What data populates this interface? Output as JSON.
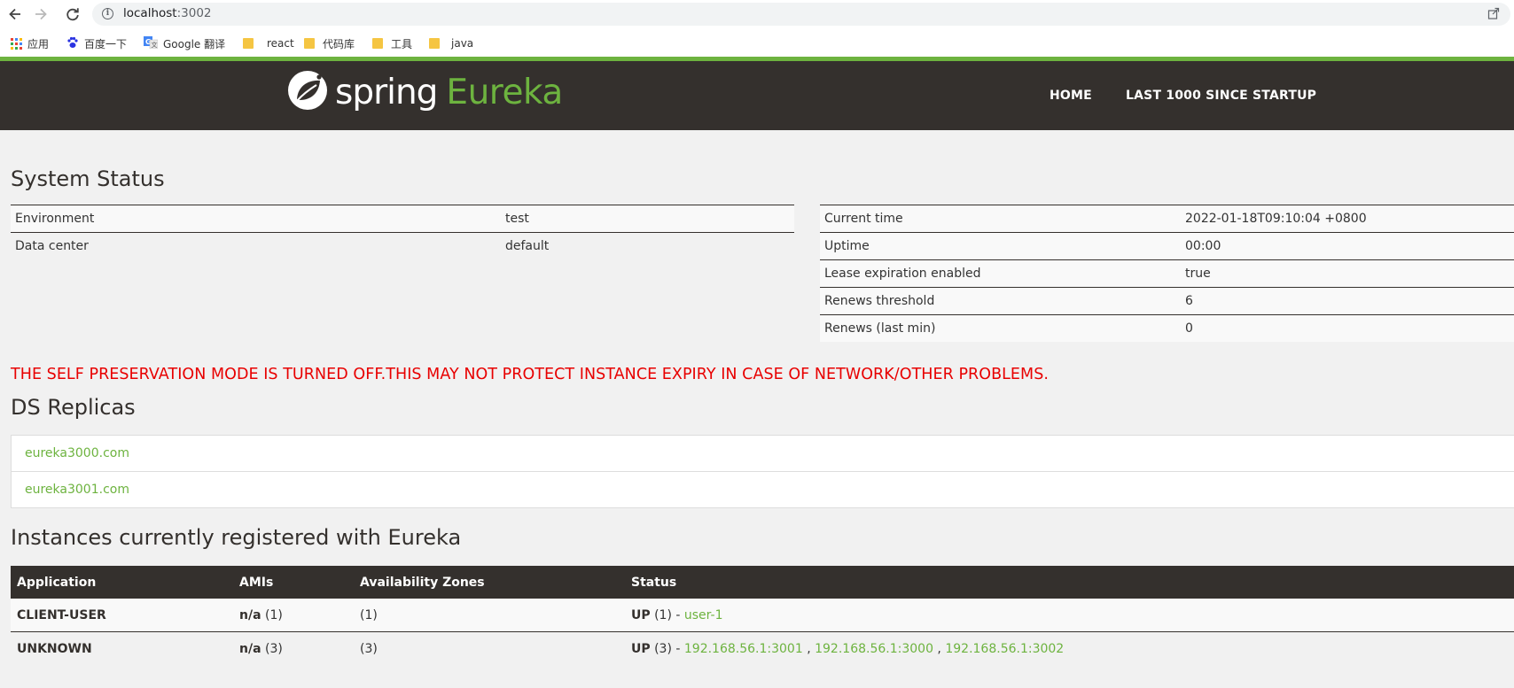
{
  "browser": {
    "url_host": "localhost",
    "url_port": ":3002",
    "bookmarks": [
      {
        "label": "应用",
        "icon": "apps-grid-icon"
      },
      {
        "label": "百度一下",
        "icon": "baidu-paw-icon"
      },
      {
        "label": "Google 翻译",
        "icon": "google-translate-icon"
      },
      {
        "label": "react",
        "icon": "folder-icon"
      },
      {
        "label": "代码库",
        "icon": "folder-icon"
      },
      {
        "label": "工具",
        "icon": "folder-icon"
      },
      {
        "label": "java",
        "icon": "folder-icon"
      }
    ]
  },
  "header": {
    "logo_spring": "spring",
    "logo_eureka": "Eureka",
    "nav": [
      "HOME",
      "LAST 1000 SINCE STARTUP"
    ]
  },
  "system_status": {
    "title": "System Status",
    "left": [
      {
        "key": "Environment",
        "value": "test"
      },
      {
        "key": "Data center",
        "value": "default"
      }
    ],
    "right": [
      {
        "key": "Current time",
        "value": "2022-01-18T09:10:04 +0800"
      },
      {
        "key": "Uptime",
        "value": "00:00"
      },
      {
        "key": "Lease expiration enabled",
        "value": "true"
      },
      {
        "key": "Renews threshold",
        "value": "6"
      },
      {
        "key": "Renews (last min)",
        "value": "0"
      }
    ]
  },
  "warning": "THE SELF PRESERVATION MODE IS TURNED OFF.THIS MAY NOT PROTECT INSTANCE EXPIRY IN CASE OF NETWORK/OTHER PROBLEMS.",
  "ds_replicas": {
    "title": "DS Replicas",
    "items": [
      "eureka3000.com",
      "eureka3001.com"
    ]
  },
  "instances": {
    "title": "Instances currently registered with Eureka",
    "columns": [
      "Application",
      "AMIs",
      "Availability Zones",
      "Status"
    ],
    "rows": [
      {
        "application": "CLIENT-USER",
        "amis_bold": "n/a",
        "amis_count": " (1)",
        "zones": "(1)",
        "status_bold": "UP",
        "status_count": " (1) - ",
        "links": [
          "user-1"
        ]
      },
      {
        "application": "UNKNOWN",
        "amis_bold": "n/a",
        "amis_count": " (3)",
        "zones": "(3)",
        "status_bold": "UP",
        "status_count": " (3) - ",
        "links": [
          "192.168.56.1:3001",
          "192.168.56.1:3000",
          "192.168.56.1:3002"
        ]
      }
    ]
  },
  "colors": {
    "spring_green": "#6db33f",
    "header_dark": "#34302d",
    "warning_red": "#e80000"
  }
}
